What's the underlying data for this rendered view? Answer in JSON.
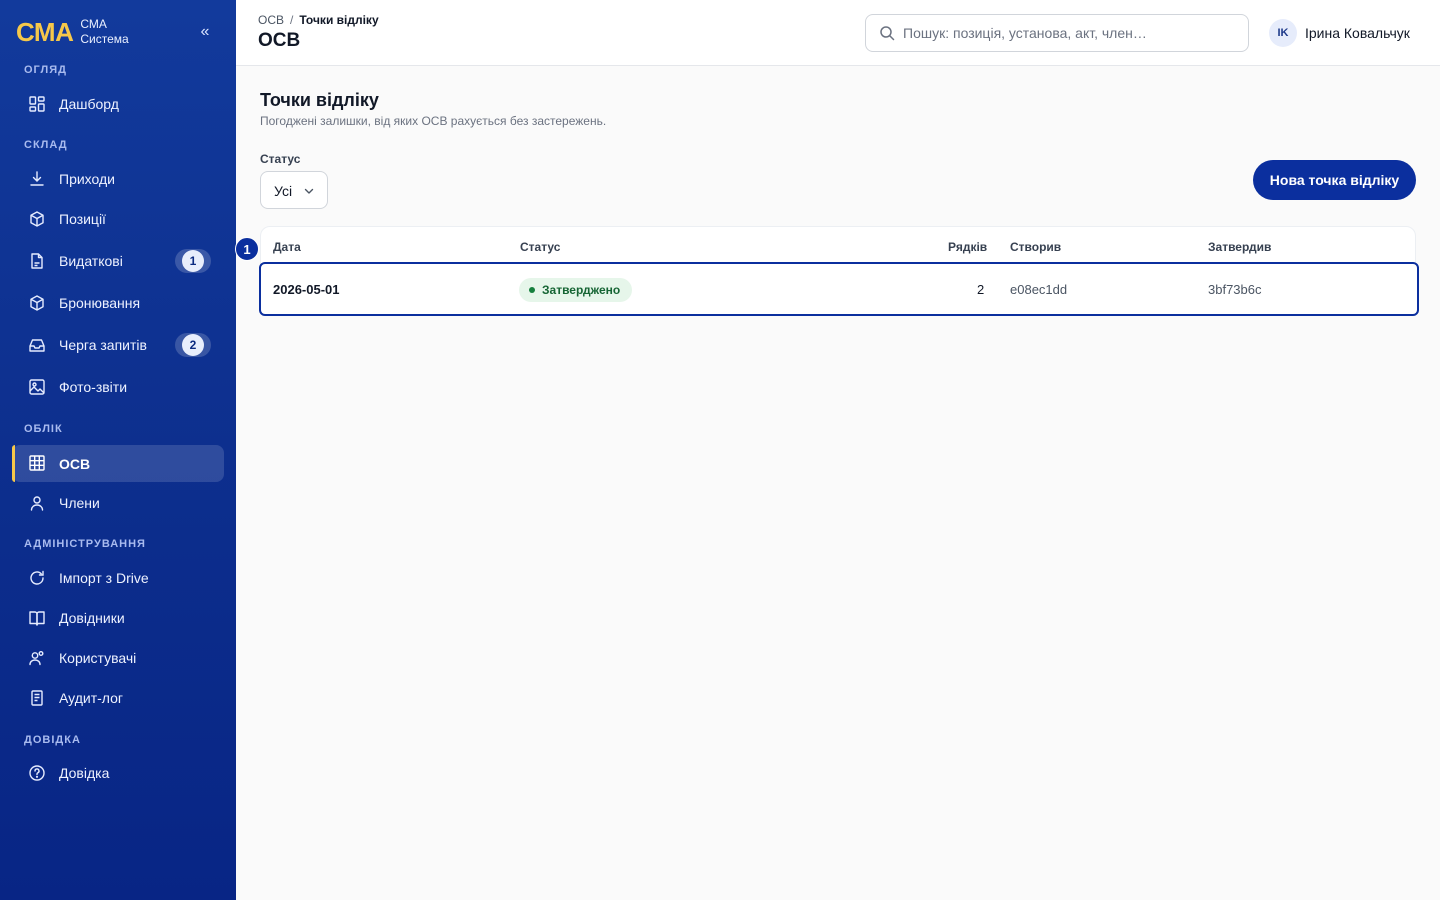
{
  "brand": {
    "logo": "СМА",
    "line1": "СМА",
    "line2": "Система",
    "collapse": "«"
  },
  "sidebar": {
    "sections": [
      {
        "label": "ОГЛЯД"
      },
      {
        "label": "СКЛАД"
      },
      {
        "label": "ОБЛІК"
      },
      {
        "label": "АДМІНІСТРУВАННЯ"
      },
      {
        "label": "ДОВІДКА"
      }
    ],
    "items": [
      {
        "label": "Дашборд",
        "icon": "dashboard-icon"
      },
      {
        "label": "Приходи",
        "icon": "download-icon"
      },
      {
        "label": "Позиції",
        "icon": "box-icon"
      },
      {
        "label": "Видаткові",
        "icon": "document-icon",
        "badge": "1"
      },
      {
        "label": "Бронювання",
        "icon": "box-icon"
      },
      {
        "label": "Черга запитів",
        "icon": "inbox-icon",
        "badge": "2"
      },
      {
        "label": "Фото-звіти",
        "icon": "image-icon"
      },
      {
        "label": "ОСВ",
        "icon": "grid-icon",
        "active": true
      },
      {
        "label": "Члени",
        "icon": "user-icon"
      },
      {
        "label": "Імпорт з Drive",
        "icon": "refresh-icon"
      },
      {
        "label": "Довідники",
        "icon": "book-icon"
      },
      {
        "label": "Користувачі",
        "icon": "users-icon"
      },
      {
        "label": "Аудит-лог",
        "icon": "log-icon"
      },
      {
        "label": "Довідка",
        "icon": "help-icon"
      }
    ]
  },
  "header": {
    "breadcrumb": [
      "ОСВ",
      "Точки відліку"
    ],
    "breadcrumb_sep": "/",
    "title": "ОСВ",
    "search_placeholder": "Пошук: позиція, установа, акт, член…",
    "user": {
      "initials": "IK",
      "name": "Ірина Ковальчук"
    }
  },
  "main": {
    "title": "Точки відліку",
    "subtitle": "Погоджені залишки, від яких ОСВ рахується без застережень.",
    "filter": {
      "label": "Статус",
      "value": "Усі"
    },
    "new_button": "Нова точка відліку",
    "table": {
      "columns": [
        "Дата",
        "Статус",
        "Рядків",
        "Створив",
        "Затвердив"
      ],
      "rows": [
        {
          "date": "2026-05-01",
          "status": "Затверджено",
          "rows": "2",
          "created_by": "e08ec1dd",
          "approved_by": "3bf73b6c"
        }
      ]
    },
    "row_marker": "1"
  },
  "colors": {
    "primary": "#0b2f9e",
    "accent": "#f6c84a",
    "success": "#15803d"
  }
}
